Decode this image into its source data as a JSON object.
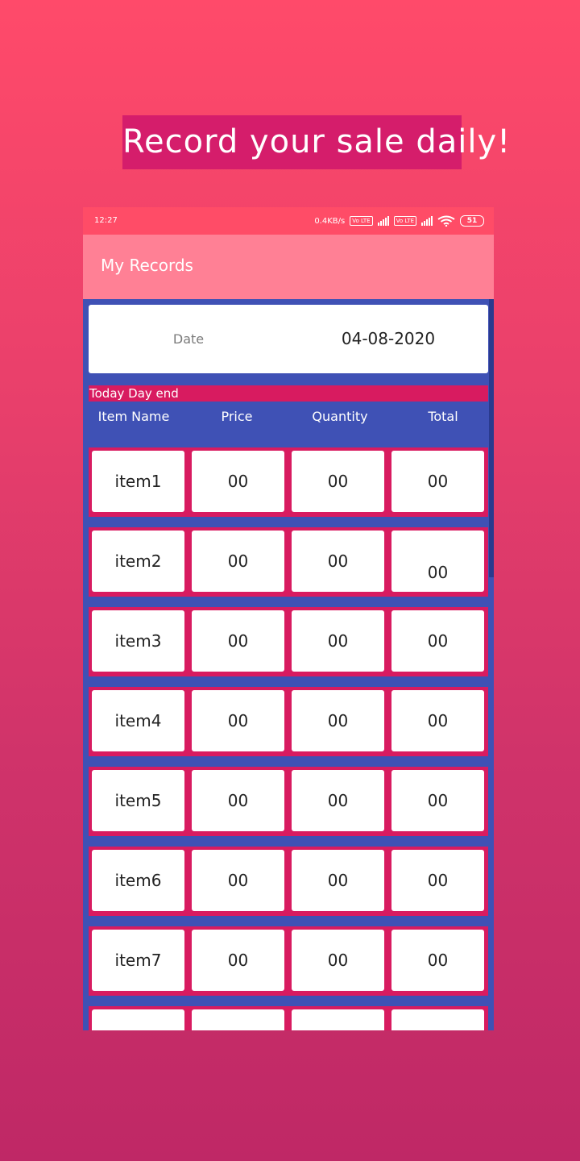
{
  "promo": {
    "title": "Record your sale daily!"
  },
  "status_bar": {
    "time": "12:27",
    "net_speed": "0.4KB/s",
    "volte_label": "Vo LTE",
    "battery": "51",
    "icons": [
      "volte-icon",
      "signal-icon",
      "wifi-icon",
      "battery-icon"
    ]
  },
  "app_bar": {
    "title": "My Records"
  },
  "date_card": {
    "label": "Date",
    "value": "04-08-2020"
  },
  "section": {
    "title": "Today Day end"
  },
  "table": {
    "headers": [
      "Item Name",
      "Price",
      "Quantity",
      "Total"
    ],
    "rows": [
      {
        "name": "item1",
        "price": "00",
        "quantity": "00",
        "total": "00"
      },
      {
        "name": "item2",
        "price": "00",
        "quantity": "00",
        "total": "00"
      },
      {
        "name": "item3",
        "price": "00",
        "quantity": "00",
        "total": "00"
      },
      {
        "name": "item4",
        "price": "00",
        "quantity": "00",
        "total": "00"
      },
      {
        "name": "item5",
        "price": "00",
        "quantity": "00",
        "total": "00"
      },
      {
        "name": "item6",
        "price": "00",
        "quantity": "00",
        "total": "00"
      },
      {
        "name": "item7",
        "price": "00",
        "quantity": "00",
        "total": "00"
      },
      {
        "name": "",
        "price": "",
        "quantity": "",
        "total": ""
      }
    ]
  },
  "colors": {
    "background_top": "#ff4a6a",
    "background_bottom": "#bf2866",
    "status_bar": "#ff4c67",
    "app_bar": "#ff8095",
    "content": "#3f51b5",
    "accent": "#d81b60"
  }
}
